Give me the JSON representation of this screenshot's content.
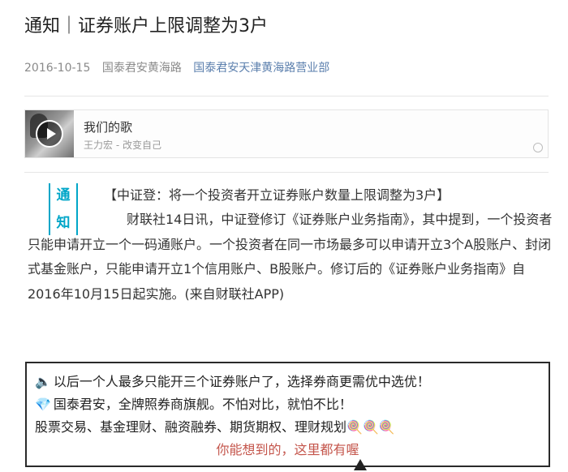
{
  "article": {
    "title": "通知｜证券账户上限调整为3户",
    "date": "2016-10-15",
    "author": "国泰君安黄海路",
    "account_link": "国泰君安天津黄海路营业部"
  },
  "music": {
    "song_title": "我们的歌",
    "artist": "王力宏 - 改变自己"
  },
  "notice": {
    "tag_char_1": "通",
    "tag_char_2": "知",
    "headline": "【中证登：将一个投资者开立证券账户数量上限调整为3户】",
    "body": "财联社14日讯，中证登修订《证券账户业务指南》，其中提到，一个投资者只能申请开立一个一码通账户。一个投资者在同一市场最多可以申请开立3个A股账户、封闭式基金账户，只能申请开立1个信用账户、B股账户。修订后的《证券账户业务指南》自2016年10月15日起实施。(来自财联社APP)"
  },
  "promo": {
    "line1_icon": "speaker-icon",
    "line1": "以后一个人最多只能开三个证券账户了，选择券商更需优中选优！",
    "line2_icon": "diamond-icon",
    "line2": "国泰君安，全牌照券商旗舰。不怕对比，就怕不比！",
    "line3": "股票交易、基金理财、融资融券、期货期权、理财规划",
    "line3_icons": "lollipop-icon",
    "line4": "你能想到的，这里都有喔",
    "accent_color": "#c4554b"
  }
}
